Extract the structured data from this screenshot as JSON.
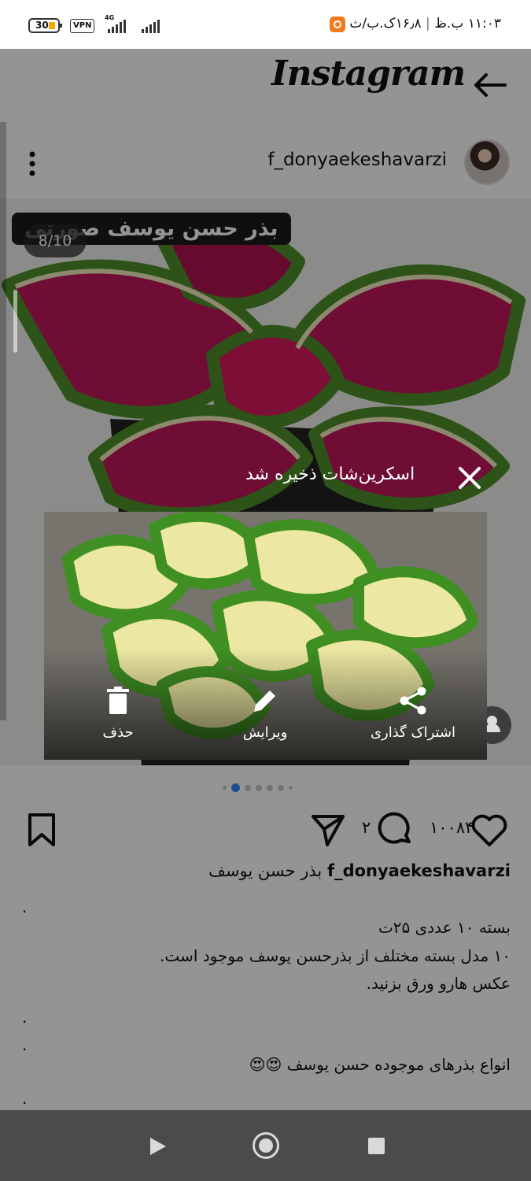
{
  "status_bar": {
    "time": "۱۱:۰۳ ب.ظ",
    "data_rate": "۱۶٫۸ک.ب/ث",
    "battery": "30",
    "vpn": "VPN",
    "network": "4G"
  },
  "header": {
    "app_title": "Instagram",
    "back_icon": "arrow-left-icon"
  },
  "post": {
    "username": "f_donyaekeshavarzi",
    "cover_title": "بذر حسن یوسف صورتی",
    "slide_counter": "8/10",
    "likes": "۱۰۰۸۴",
    "comments": "۲",
    "caption_username": "f_donyaekeshavarzi",
    "caption_text": "بذر حسن یوسف",
    "body_lines": [
      "بسته ۱۰ عددی ۲۵ت",
      "۱۰ مدل بسته مختلف از بذرحسن یوسف موجود است.",
      "عکس هارو ورق بزنید.",
      "انواع بذرهای موجوده حسن یوسف 😍😍"
    ],
    "dot_line": "."
  },
  "screenshot_toast": {
    "title": "اسکرین‌شات ذخیره شد",
    "actions": {
      "share": "اشتراک گذاری",
      "edit": "ویرایش",
      "delete": "حذف"
    }
  },
  "colors": {
    "accent_blue": "#3b82f6",
    "overlay": "rgba(0,0,0,0.42)",
    "nav_bar": "#4b4b4b"
  }
}
